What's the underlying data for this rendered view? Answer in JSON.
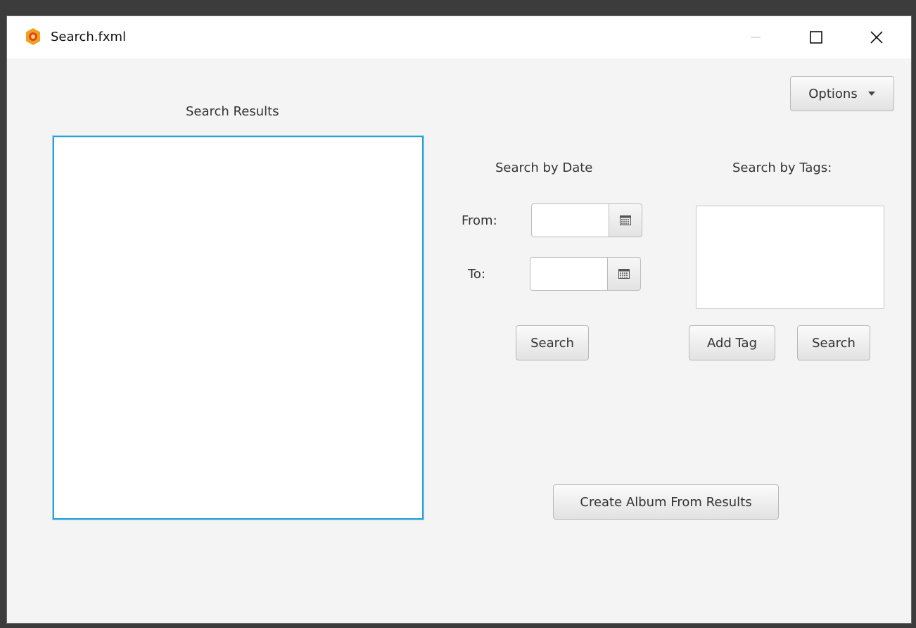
{
  "window": {
    "title": "Search.fxml",
    "icon": "app-flame-icon",
    "controls": [
      "minimize-icon",
      "maximize-icon",
      "close-icon"
    ]
  },
  "options_menu": {
    "label": "Options",
    "icon": "caret-down-icon"
  },
  "results": {
    "heading": "Search Results"
  },
  "date_search": {
    "heading": "Search by Date",
    "from_label": "From:",
    "from_value": "",
    "to_label": "To:",
    "to_value": "",
    "calendar_icon": "calendar-icon",
    "search_label": "Search"
  },
  "tag_search": {
    "heading": "Search by Tags:",
    "add_tag_label": "Add Tag",
    "search_label": "Search"
  },
  "create_album": {
    "label": "Create Album From Results"
  },
  "colors": {
    "accent_focus": "#2aa0d9",
    "app_icon": "#f0a020",
    "background": "#f4f4f4"
  }
}
